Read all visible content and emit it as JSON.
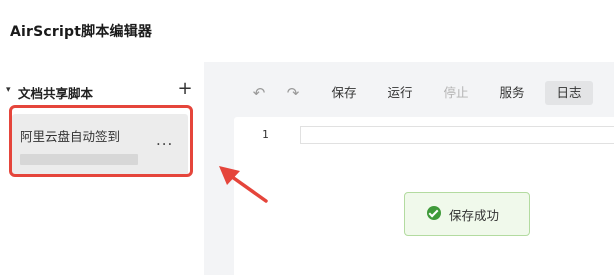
{
  "app": {
    "title": "AirScript脚本编辑器"
  },
  "sidebar": {
    "section_label": "文档共享脚本",
    "caret": "▾",
    "add_label": "+",
    "items": [
      {
        "name": "阿里云盘自动签到",
        "more_label": "..."
      }
    ]
  },
  "toolbar": {
    "undo_label": "↶",
    "redo_label": "↷",
    "save_label": "保存",
    "run_label": "运行",
    "stop_label": "停止",
    "service_label": "服务",
    "log_label": "日志"
  },
  "editor": {
    "line_numbers": [
      "1"
    ]
  },
  "toast": {
    "message": "保存成功"
  },
  "colors": {
    "annotation_red": "#e5453b",
    "toast_bg": "#f0f9eb",
    "toast_border": "#b3dba0",
    "success_green": "#3f9a3a",
    "editor_bg": "#f3f4f6"
  },
  "icons": [
    "caret-down-icon",
    "add-icon",
    "more-icon",
    "undo-icon",
    "redo-icon",
    "success-check-icon",
    "annotation-arrow-icon"
  ]
}
